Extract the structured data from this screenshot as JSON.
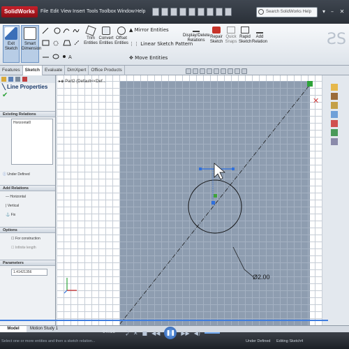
{
  "app": {
    "logo": "SolidWorks"
  },
  "menu": [
    "File",
    "Edit",
    "View",
    "Insert",
    "Tools",
    "Toolbox",
    "Window",
    "Help"
  ],
  "search": {
    "placeholder": "Search SolidWorks Help"
  },
  "ribbon": {
    "exit_sketch": "Exit Sketch",
    "smart_dimension": "Smart Dimension",
    "trim": "Trim Entities",
    "convert": "Convert Entities",
    "offset": "Offset Entities",
    "mirror": "Mirror Entities",
    "linear_pattern": "Linear Sketch Pattern",
    "move": "Move Entities",
    "display_delete": "Display/Delete Relations",
    "repair": "Repair Sketch",
    "quick_snaps": "Quick Snaps",
    "rapid_sketch": "Rapid Sketch",
    "add_relation": "Add Relation"
  },
  "tabs": [
    "Features",
    "Sketch",
    "Evaluate",
    "DimXpert",
    "Office Products"
  ],
  "property_manager": {
    "title": "Line Properties",
    "existing_relations": "Existing Relations",
    "relation_item": "Horizontal0",
    "under_defined": "Under Defined",
    "add_relations": "Add Relations",
    "relations": [
      "Horizontal",
      "Vertical",
      "Fix"
    ],
    "options": "Options",
    "for_construction": "For construction",
    "infinite_length": "Infinite length",
    "parameters": "Parameters",
    "param_value": "1.41421356"
  },
  "tree": {
    "label": "Part2 (Default<<Def..."
  },
  "sketch": {
    "dimension": "Ø2.00"
  },
  "bottom_tabs": [
    "Model",
    "Motion Study 1"
  ],
  "status": {
    "hint": "Select one or more entities and then a sketch relation...",
    "under_defined": "Under Defined",
    "editing": "Editing Sketch4"
  },
  "player": {
    "time": "04:56"
  },
  "colors": {
    "sheet": "#8e9db0",
    "selection": "#2f6fdc",
    "accent": "#c8202a"
  }
}
